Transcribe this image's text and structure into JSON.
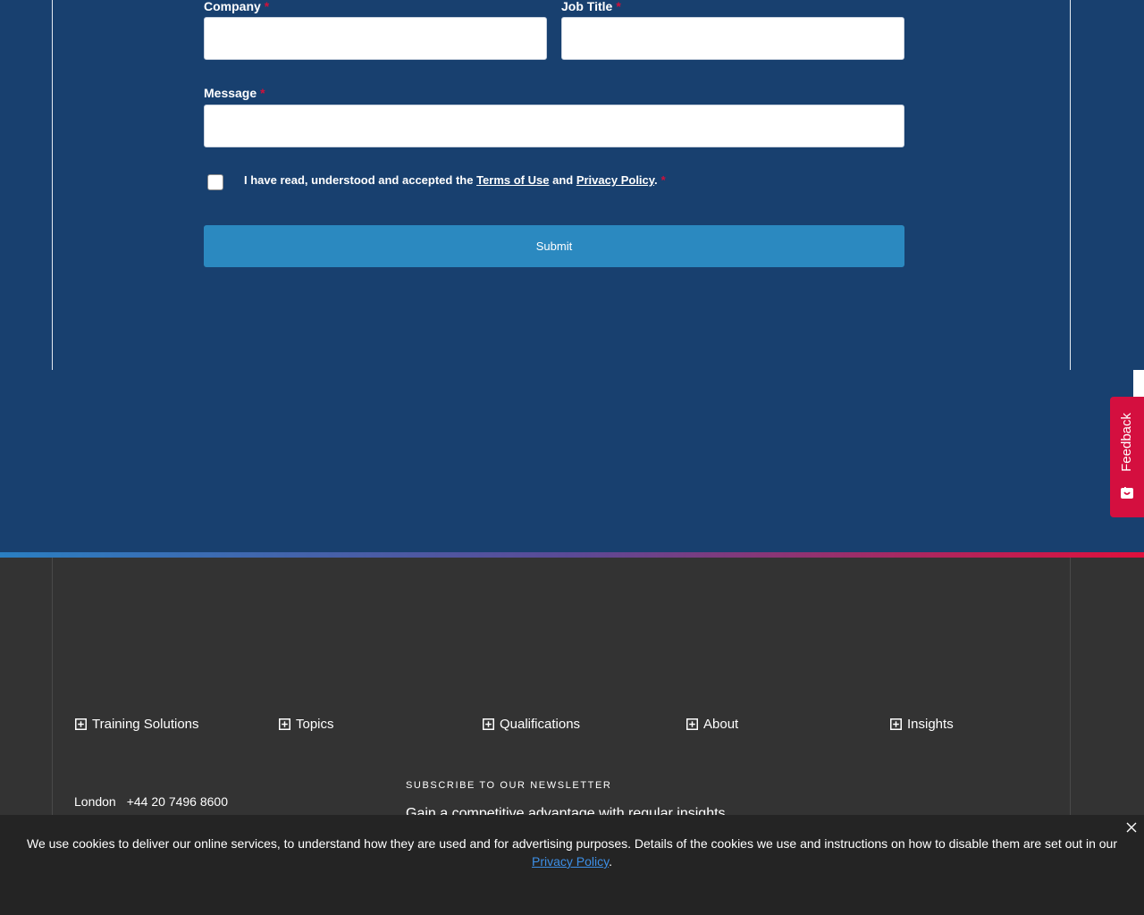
{
  "form": {
    "company_label": "Company",
    "job_title_label": "Job Title",
    "message_label": "Message",
    "required_marker": "*",
    "company_value": "",
    "job_title_value": "",
    "message_value": "",
    "consent": {
      "prefix": "I have read, understood and accepted the ",
      "terms_link": "Terms of Use",
      "middle": " and ",
      "privacy_link": "Privacy Policy",
      "suffix": ".",
      "checked": false
    },
    "submit_label": "Submit"
  },
  "feedback_tab": {
    "label": "Feedback"
  },
  "footer": {
    "nav": [
      {
        "label": "Training Solutions"
      },
      {
        "label": "Topics"
      },
      {
        "label": "Qualifications"
      },
      {
        "label": "About"
      },
      {
        "label": "Insights"
      }
    ],
    "office": {
      "city": "London",
      "phone": "+44 20 7496 8600"
    },
    "newsletter": {
      "heading": "SUBSCRIBE TO OUR NEWSLETTER",
      "text": "Gain a competitive advantage with regular insights"
    }
  },
  "cookie_banner": {
    "text": "We use cookies to deliver our online services, to understand how they are used and for advertising purposes. Details of the cookies we use and instructions on how to disable them are set out in our ",
    "link": "Privacy Policy",
    "suffix": "."
  },
  "colors": {
    "brand_blue": "#18406f",
    "submit_blue": "#2b89c0",
    "accent_red": "#d40f3f",
    "footer_bg": "#333333",
    "cookie_bg": "#242424",
    "link_blue": "#3d8fe6"
  },
  "icons": [
    "feedback-icon",
    "plus-box-icon",
    "close-icon"
  ]
}
